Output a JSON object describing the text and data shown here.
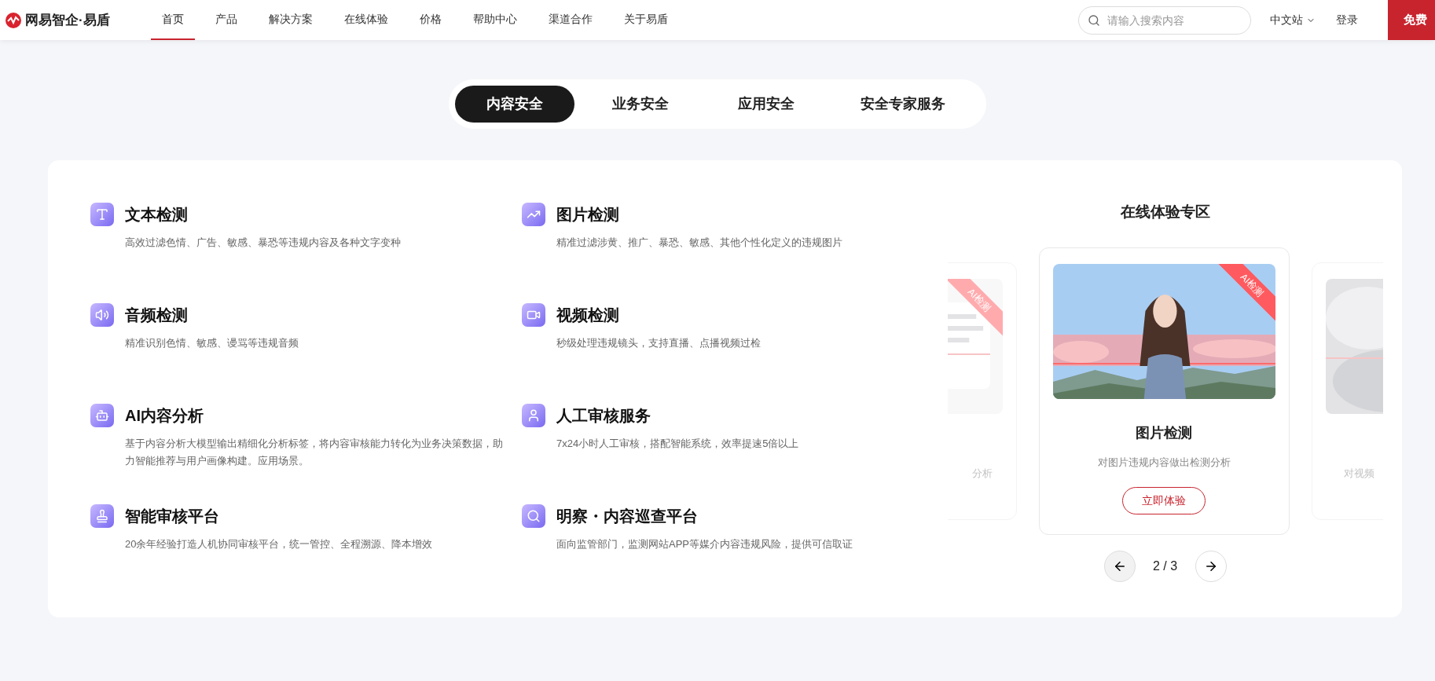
{
  "nav": {
    "logo": "网易智企·易盾",
    "items": [
      {
        "label": "首页",
        "selected": true
      },
      {
        "label": "产品",
        "selected": false
      },
      {
        "label": "解决方案",
        "selected": false
      },
      {
        "label": "在线体验",
        "selected": false
      },
      {
        "label": "价格",
        "selected": false
      },
      {
        "label": "帮助中心",
        "selected": false
      },
      {
        "label": "渠道合作",
        "selected": false
      },
      {
        "label": "关于易盾",
        "selected": false
      }
    ],
    "search": {
      "placeholder": "请输入搜索内容"
    },
    "language": "中文站",
    "login": "登录",
    "cta": "免费"
  },
  "tabs": [
    {
      "label": "内容安全",
      "selected": true
    },
    {
      "label": "业务安全",
      "selected": false
    },
    {
      "label": "应用安全",
      "selected": false
    },
    {
      "label": "安全专家服务",
      "selected": false
    }
  ],
  "features": [
    {
      "kind": "text",
      "title": "文本检测",
      "desc": "高效过滤色情、广告、敏感、暴恐等违规内容及各种文字变种"
    },
    {
      "title": "图片检测",
      "desc": "精准过滤涉黄、推广、暴恐、敏感、其他个性化定义的违规图片"
    },
    {
      "kind": "audio",
      "title": "音频检测",
      "desc": "精准识别色情、敏感、谩骂等违规音频"
    },
    {
      "kind": "video",
      "title": "视频检测",
      "desc": "秒级处理违规镜头，支持直播、点播视频过检"
    },
    {
      "kind": "ai",
      "title": "AI内容分析",
      "desc": "基于内容分析大模型输出精细化分析标签，将内容审核能力转化为业务决策数据，助力智能推荐与用户画像构建。应用场景。"
    },
    {
      "kind": "person",
      "title": "人工审核服务",
      "desc": "7x24小时人工审核，搭配智能系统，效率提速5倍以上"
    },
    {
      "kind": "stamp",
      "title": "智能审核平台",
      "desc": "20余年经验打造人机协同审核平台，统一管控、全程溯源、降本增效"
    },
    {
      "kind": "search",
      "title": "明察・内容巡查平台",
      "desc": "面向监管部门，监测网站APP等媒介内容违规风险，提供可信取证"
    }
  ],
  "showcase": {
    "title": "在线体验专区",
    "cards": [
      {
        "kind": "document",
        "badge": "AI检测",
        "desc": "分析"
      },
      {
        "badge": "AI检测",
        "title": "图片检测",
        "desc": "对图片违规内容做出检测分析",
        "button": "立即体验"
      },
      {
        "kind": "sculpture",
        "desc": "对视频"
      }
    ],
    "pager": "2 / 3"
  }
}
